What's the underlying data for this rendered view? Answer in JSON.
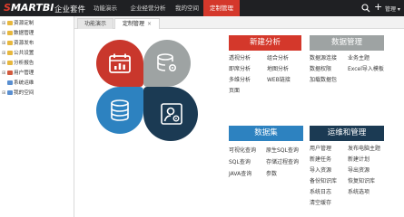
{
  "brand": {
    "logo_s": "S",
    "logo_rest": "MARTBI",
    "suite": "企业套件"
  },
  "nav": {
    "items": [
      "功能演示",
      "企业经营分析",
      "我的空间",
      "定制管理"
    ],
    "active_index": 3,
    "user_label": "管理"
  },
  "sidebar": {
    "items": [
      {
        "label": "资源定制",
        "toggle": "⊞",
        "color": "#e6b73f"
      },
      {
        "label": "数据管理",
        "toggle": "⊞",
        "color": "#e6b73f"
      },
      {
        "label": "资源发布",
        "toggle": "⊞",
        "color": "#e6b73f"
      },
      {
        "label": "公共设置",
        "toggle": "⊞",
        "color": "#e6b73f"
      },
      {
        "label": "分析报告",
        "toggle": "⊞",
        "color": "#e6b73f"
      },
      {
        "label": "用户管理",
        "toggle": "⊞",
        "color": "#d25a3d"
      },
      {
        "label": "系统运维",
        "toggle": "",
        "color": "#5a8fd0"
      },
      {
        "label": "我的空间",
        "toggle": "⊞",
        "color": "#5a8fd0"
      }
    ]
  },
  "tabs": [
    {
      "label": "功能演示",
      "active": false
    },
    {
      "label": "定制管理",
      "active": true,
      "close": "×"
    }
  ],
  "panels": {
    "new_analysis": {
      "title": "新建分析",
      "color": "#d4382b",
      "links": [
        "透视分析",
        "即席分析",
        "多维分析",
        "页面",
        "组合分析",
        "地图分析",
        "WEB链接"
      ]
    },
    "data_mgmt": {
      "title": "数据管理",
      "color": "#9ea3a3",
      "links": [
        "数据源连接",
        "数据权限",
        "加载数据包",
        "业务主题",
        "Excel导入模板"
      ]
    },
    "dataset": {
      "title": "数据集",
      "color": "#2d82c0",
      "links": [
        "可视化查询",
        "SQL查询",
        "JAVA查询",
        "原生SQL查询",
        "存储过程查询",
        "参数"
      ]
    },
    "ops": {
      "title": "运维和管理",
      "color": "#1b3a53",
      "links": [
        "用户管理",
        "新建任务",
        "导入资源",
        "备份知识库",
        "系统日志",
        "清空缓存",
        "发布电脑主题",
        "新建计划",
        "导出资源",
        "恢复知识库",
        "系统选项"
      ]
    }
  }
}
